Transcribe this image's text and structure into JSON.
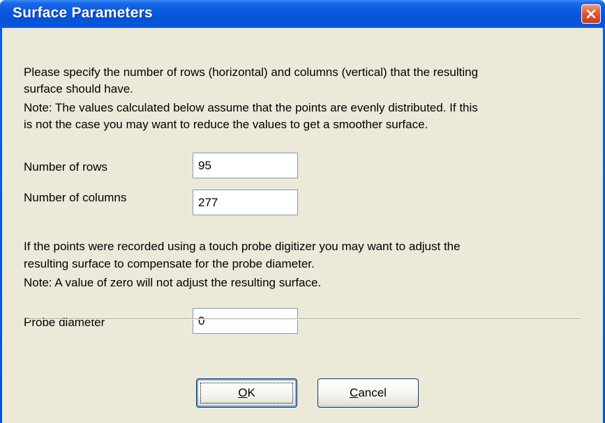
{
  "window": {
    "title": "Surface Parameters",
    "close_icon": "close-icon"
  },
  "intro": {
    "line1": "Please specify the number of rows (horizontal) and columns (vertical) that the resulting",
    "line2": "surface should have.",
    "line3": "Note: The values calculated below assume that the points are evenly distributed. If this",
    "line4": "is not the case you may want to reduce the values to get a smoother surface."
  },
  "rows": {
    "label": "Number of rows",
    "value": "95"
  },
  "columns": {
    "label": "Number of columns",
    "value": "277"
  },
  "probe_info": {
    "line1": "If the points were recorded using a touch probe digitizer you may want to adjust the",
    "line2": "resulting surface to compensate for the probe diameter.",
    "line3": "Note: A value of zero will not adjust the resulting surface."
  },
  "probe": {
    "label": "Probe diameter",
    "value": "0"
  },
  "buttons": {
    "ok_mnemonic": "O",
    "ok_rest": "K",
    "cancel_mnemonic": "C",
    "cancel_rest": "ancel"
  },
  "colors": {
    "title_bar": "#0a58dd",
    "dialog_face": "#ece9d8",
    "close_button": "#e2583a"
  }
}
